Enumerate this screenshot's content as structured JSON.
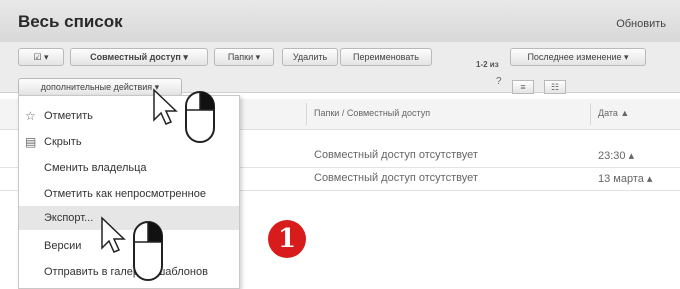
{
  "header": {
    "title": "Весь список",
    "refresh": "Обновить"
  },
  "toolbar": {
    "select_label": "☑ ▾",
    "buttons": [
      "Совместный доступ ▾",
      "Папки ▾",
      "Удалить",
      "Переименовать"
    ],
    "more_actions": "дополнительные действия ▾",
    "count": "1-2 из",
    "help": "?",
    "sort_label": "Последнее изменение ▾",
    "view": [
      "≡",
      "☷"
    ]
  },
  "table": {
    "columns": [
      "Папки / Совместный доступ",
      "Дата ▲"
    ],
    "rows": [
      {
        "sharing": "Совместный доступ отсутствует",
        "date": "23:30 ▴"
      },
      {
        "sharing": "Совместный доступ отсутствует",
        "date": "13 марта ▴"
      }
    ]
  },
  "menu": {
    "items": [
      {
        "label": "Отметить",
        "icon": "star-icon"
      },
      {
        "label": "Скрыть",
        "icon": "hide-icon"
      },
      {
        "label": "Сменить владельца",
        "icon": ""
      },
      {
        "label": "Отметить как непросмотренное",
        "icon": ""
      },
      {
        "label": "Экспорт...",
        "icon": ""
      },
      {
        "label": "Версии",
        "icon": ""
      },
      {
        "label": "Отправить в галерею шаблонов",
        "icon": ""
      }
    ]
  },
  "annotation": {
    "number": "1"
  },
  "colors": {
    "badge": "#d81b1b",
    "menu_highlight": "#e6e6e6",
    "titlebar": "#dddddd"
  }
}
